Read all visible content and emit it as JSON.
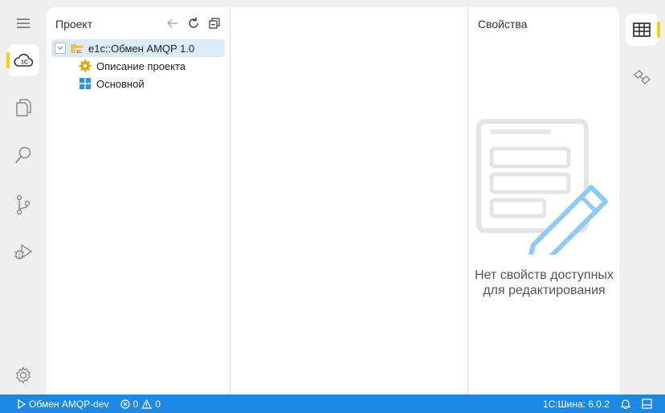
{
  "activity": {
    "items": [
      {
        "name": "menu"
      },
      {
        "name": "cloud-1c",
        "active": true
      },
      {
        "name": "explorer"
      },
      {
        "name": "search"
      },
      {
        "name": "source-control"
      },
      {
        "name": "run-debug"
      },
      {
        "name": "settings"
      }
    ]
  },
  "project": {
    "title": "Проект",
    "tree": [
      {
        "label": "e1c::Обмен AMQP 1.0",
        "icon": "project-folder-icon",
        "selected": true,
        "expanded": true
      },
      {
        "label": "Описание проекта",
        "icon": "gear-icon"
      },
      {
        "label": "Основной",
        "icon": "module-icon"
      }
    ]
  },
  "properties": {
    "title": "Свойства",
    "empty_text": "Нет свойств доступных для редактирования"
  },
  "status": {
    "run_label": "Обмен AMQP-dev",
    "errors": "0",
    "warnings": "0",
    "version": "1С:Шина: 6.0.2"
  },
  "colors": {
    "accent": "#1e88e5",
    "active_marker": "#f5d300",
    "selection": "#dcebfa"
  }
}
